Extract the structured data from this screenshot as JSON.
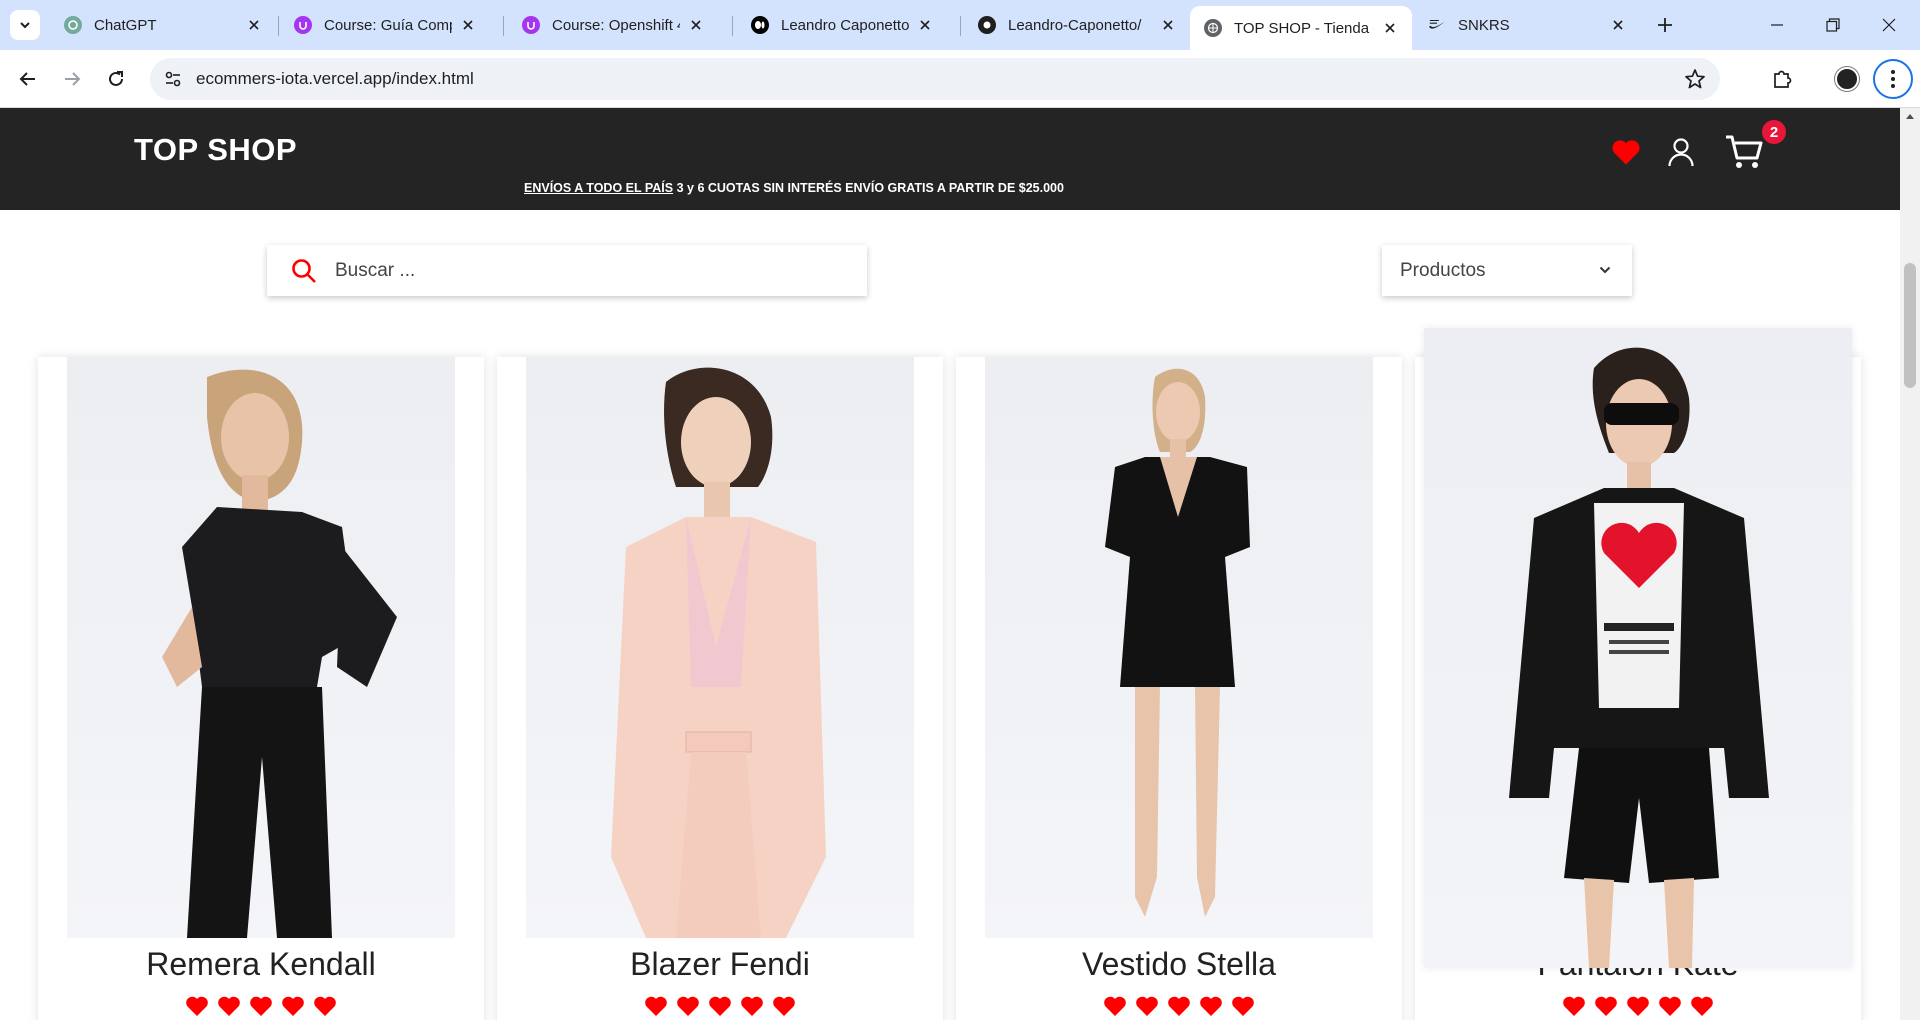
{
  "browser": {
    "tabs": [
      {
        "title": "ChatGPT",
        "favicon": "chatgpt-icon"
      },
      {
        "title": "Course: Guía Comple",
        "favicon": "udemy-icon"
      },
      {
        "title": "Course: Openshift 4 c",
        "favicon": "udemy-icon"
      },
      {
        "title": "Leandro Caponetto |",
        "favicon": "medium-icon"
      },
      {
        "title": "Leandro-Caponetto/",
        "favicon": "github-icon"
      },
      {
        "title": "TOP SHOP - Tienda c",
        "favicon": "globe-icon",
        "active": true
      },
      {
        "title": "SNKRS",
        "favicon": "nike-icon"
      }
    ],
    "url": "ecommers-iota.vercel.app/index.html"
  },
  "site": {
    "logo": "TOP SHOP",
    "promo_link": "ENVÍOS A TODO EL PAÍS",
    "promo_text": "3 y 6 CUOTAS SIN INTERÉS ENVÍO GRATIS A PARTIR DE $25.000",
    "cart_count": "2",
    "accent_color": "#ff0000",
    "header_color": "#242424"
  },
  "search": {
    "placeholder": "Buscar ..."
  },
  "filter": {
    "selected": "Productos"
  },
  "products": [
    {
      "name": "Remera Kendall",
      "rating": 5
    },
    {
      "name": "Blazer Fendi",
      "rating": 5
    },
    {
      "name": "Vestido Stella",
      "rating": 5
    },
    {
      "name": "Pantalon Kate",
      "rating": 5
    }
  ]
}
